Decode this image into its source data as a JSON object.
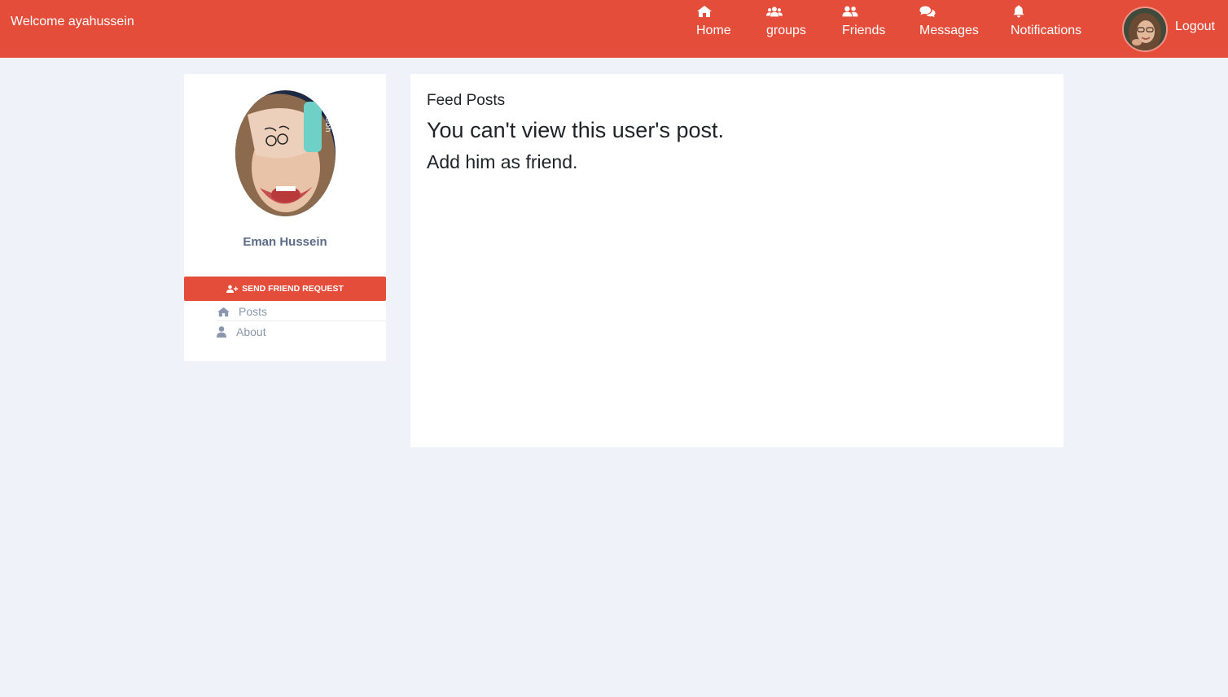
{
  "header": {
    "welcome": "Welcome ayahussein",
    "nav": [
      {
        "label": "Home",
        "icon": "home-icon"
      },
      {
        "label": "groups",
        "icon": "users-icon"
      },
      {
        "label": "Friends",
        "icon": "user-friends-icon"
      },
      {
        "label": "Messages",
        "icon": "comments-icon"
      },
      {
        "label": "Notifications",
        "icon": "bell-icon"
      }
    ],
    "logout": "Logout"
  },
  "profile": {
    "name": "Eman Hussein",
    "friend_request_label": "SEND FRIEND REQUEST",
    "links": [
      {
        "label": "Posts",
        "icon": "home-icon"
      },
      {
        "label": "About",
        "icon": "user-icon"
      }
    ]
  },
  "feed": {
    "title": "Feed Posts",
    "message": "You can't view this user's post.",
    "hint": "Add him as friend."
  },
  "colors": {
    "accent": "#e44d3a",
    "background": "#eff2f9",
    "muted_text": "#8a97ad"
  }
}
